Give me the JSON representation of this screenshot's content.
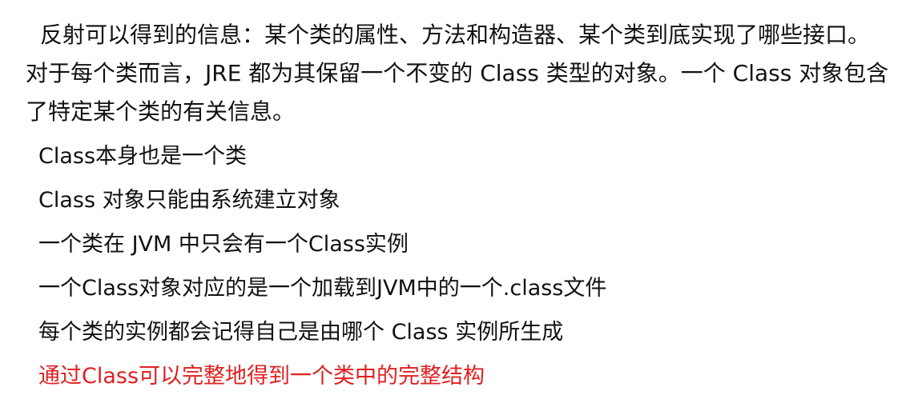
{
  "intro": "反射可以得到的信息：某个类的属性、方法和构造器、某个类到底实现了哪些接口。对于每个类而言，JRE 都为其保留一个不变的 Class 类型的对象。一个 Class 对象包含了特定某个类的有关信息。",
  "bullets": [
    {
      "text": "Class本身也是一个类"
    },
    {
      "text": "Class 对象只能由系统建立对象"
    },
    {
      "text": "一个类在 JVM 中只会有一个Class实例"
    },
    {
      "text": "一个Class对象对应的是一个加载到JVM中的一个.class文件"
    },
    {
      "text": "每个类的实例都会记得自己是由哪个 Class 实例所生成"
    },
    {
      "text": "通过Class可以完整地得到一个类中的完整结构"
    }
  ],
  "colors": {
    "text": "#111111",
    "highlight": "#e02020",
    "background": "#ffffff"
  }
}
